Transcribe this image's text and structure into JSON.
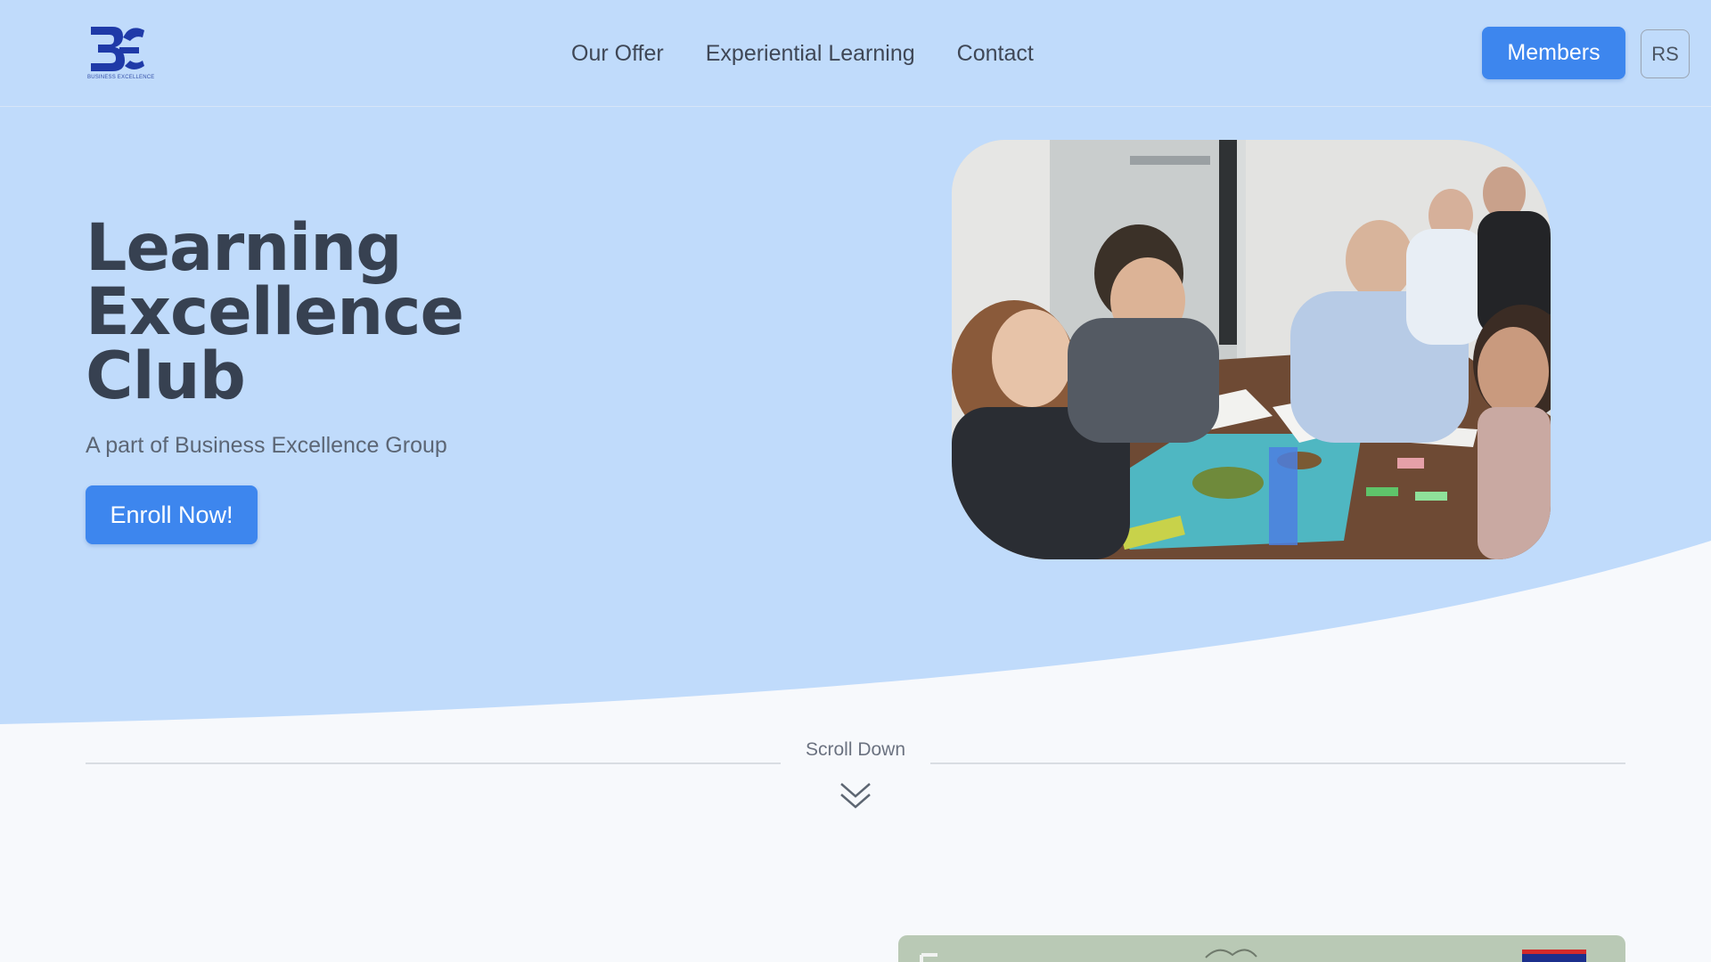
{
  "brand": {
    "logo_text": "BUSINESS EXCELLENCE",
    "logo_color": "#1f3aa8"
  },
  "nav": {
    "items": [
      "Our Offer",
      "Experiential Learning",
      "Contact"
    ]
  },
  "header": {
    "members_label": "Members",
    "language_label": "RS"
  },
  "hero": {
    "title_line1": "Learning",
    "title_line2": "Excellence",
    "title_line3": "Club",
    "subtitle": "A part of Business Excellence Group",
    "cta_label": "Enroll Now!"
  },
  "scroll": {
    "label": "Scroll Down"
  },
  "colors": {
    "hero_bg": "#c0dbfb",
    "page_bg": "#f7f9fc",
    "accent": "#3d86ee",
    "heading": "#374151"
  },
  "icons": {
    "scroll": "chevron-double-down-icon"
  }
}
